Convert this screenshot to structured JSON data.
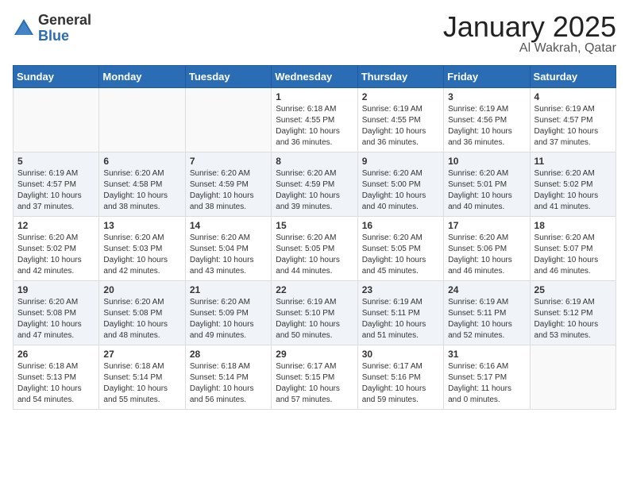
{
  "header": {
    "logo_general": "General",
    "logo_blue": "Blue",
    "title": "January 2025",
    "subtitle": "Al Wakrah, Qatar"
  },
  "days_of_week": [
    "Sunday",
    "Monday",
    "Tuesday",
    "Wednesday",
    "Thursday",
    "Friday",
    "Saturday"
  ],
  "weeks": [
    [
      {
        "day": "",
        "info": ""
      },
      {
        "day": "",
        "info": ""
      },
      {
        "day": "",
        "info": ""
      },
      {
        "day": "1",
        "info": "Sunrise: 6:18 AM\nSunset: 4:55 PM\nDaylight: 10 hours\nand 36 minutes."
      },
      {
        "day": "2",
        "info": "Sunrise: 6:19 AM\nSunset: 4:55 PM\nDaylight: 10 hours\nand 36 minutes."
      },
      {
        "day": "3",
        "info": "Sunrise: 6:19 AM\nSunset: 4:56 PM\nDaylight: 10 hours\nand 36 minutes."
      },
      {
        "day": "4",
        "info": "Sunrise: 6:19 AM\nSunset: 4:57 PM\nDaylight: 10 hours\nand 37 minutes."
      }
    ],
    [
      {
        "day": "5",
        "info": "Sunrise: 6:19 AM\nSunset: 4:57 PM\nDaylight: 10 hours\nand 37 minutes."
      },
      {
        "day": "6",
        "info": "Sunrise: 6:20 AM\nSunset: 4:58 PM\nDaylight: 10 hours\nand 38 minutes."
      },
      {
        "day": "7",
        "info": "Sunrise: 6:20 AM\nSunset: 4:59 PM\nDaylight: 10 hours\nand 38 minutes."
      },
      {
        "day": "8",
        "info": "Sunrise: 6:20 AM\nSunset: 4:59 PM\nDaylight: 10 hours\nand 39 minutes."
      },
      {
        "day": "9",
        "info": "Sunrise: 6:20 AM\nSunset: 5:00 PM\nDaylight: 10 hours\nand 40 minutes."
      },
      {
        "day": "10",
        "info": "Sunrise: 6:20 AM\nSunset: 5:01 PM\nDaylight: 10 hours\nand 40 minutes."
      },
      {
        "day": "11",
        "info": "Sunrise: 6:20 AM\nSunset: 5:02 PM\nDaylight: 10 hours\nand 41 minutes."
      }
    ],
    [
      {
        "day": "12",
        "info": "Sunrise: 6:20 AM\nSunset: 5:02 PM\nDaylight: 10 hours\nand 42 minutes."
      },
      {
        "day": "13",
        "info": "Sunrise: 6:20 AM\nSunset: 5:03 PM\nDaylight: 10 hours\nand 42 minutes."
      },
      {
        "day": "14",
        "info": "Sunrise: 6:20 AM\nSunset: 5:04 PM\nDaylight: 10 hours\nand 43 minutes."
      },
      {
        "day": "15",
        "info": "Sunrise: 6:20 AM\nSunset: 5:05 PM\nDaylight: 10 hours\nand 44 minutes."
      },
      {
        "day": "16",
        "info": "Sunrise: 6:20 AM\nSunset: 5:05 PM\nDaylight: 10 hours\nand 45 minutes."
      },
      {
        "day": "17",
        "info": "Sunrise: 6:20 AM\nSunset: 5:06 PM\nDaylight: 10 hours\nand 46 minutes."
      },
      {
        "day": "18",
        "info": "Sunrise: 6:20 AM\nSunset: 5:07 PM\nDaylight: 10 hours\nand 46 minutes."
      }
    ],
    [
      {
        "day": "19",
        "info": "Sunrise: 6:20 AM\nSunset: 5:08 PM\nDaylight: 10 hours\nand 47 minutes."
      },
      {
        "day": "20",
        "info": "Sunrise: 6:20 AM\nSunset: 5:08 PM\nDaylight: 10 hours\nand 48 minutes."
      },
      {
        "day": "21",
        "info": "Sunrise: 6:20 AM\nSunset: 5:09 PM\nDaylight: 10 hours\nand 49 minutes."
      },
      {
        "day": "22",
        "info": "Sunrise: 6:19 AM\nSunset: 5:10 PM\nDaylight: 10 hours\nand 50 minutes."
      },
      {
        "day": "23",
        "info": "Sunrise: 6:19 AM\nSunset: 5:11 PM\nDaylight: 10 hours\nand 51 minutes."
      },
      {
        "day": "24",
        "info": "Sunrise: 6:19 AM\nSunset: 5:11 PM\nDaylight: 10 hours\nand 52 minutes."
      },
      {
        "day": "25",
        "info": "Sunrise: 6:19 AM\nSunset: 5:12 PM\nDaylight: 10 hours\nand 53 minutes."
      }
    ],
    [
      {
        "day": "26",
        "info": "Sunrise: 6:18 AM\nSunset: 5:13 PM\nDaylight: 10 hours\nand 54 minutes."
      },
      {
        "day": "27",
        "info": "Sunrise: 6:18 AM\nSunset: 5:14 PM\nDaylight: 10 hours\nand 55 minutes."
      },
      {
        "day": "28",
        "info": "Sunrise: 6:18 AM\nSunset: 5:14 PM\nDaylight: 10 hours\nand 56 minutes."
      },
      {
        "day": "29",
        "info": "Sunrise: 6:17 AM\nSunset: 5:15 PM\nDaylight: 10 hours\nand 57 minutes."
      },
      {
        "day": "30",
        "info": "Sunrise: 6:17 AM\nSunset: 5:16 PM\nDaylight: 10 hours\nand 59 minutes."
      },
      {
        "day": "31",
        "info": "Sunrise: 6:16 AM\nSunset: 5:17 PM\nDaylight: 11 hours\nand 0 minutes."
      },
      {
        "day": "",
        "info": ""
      }
    ]
  ]
}
